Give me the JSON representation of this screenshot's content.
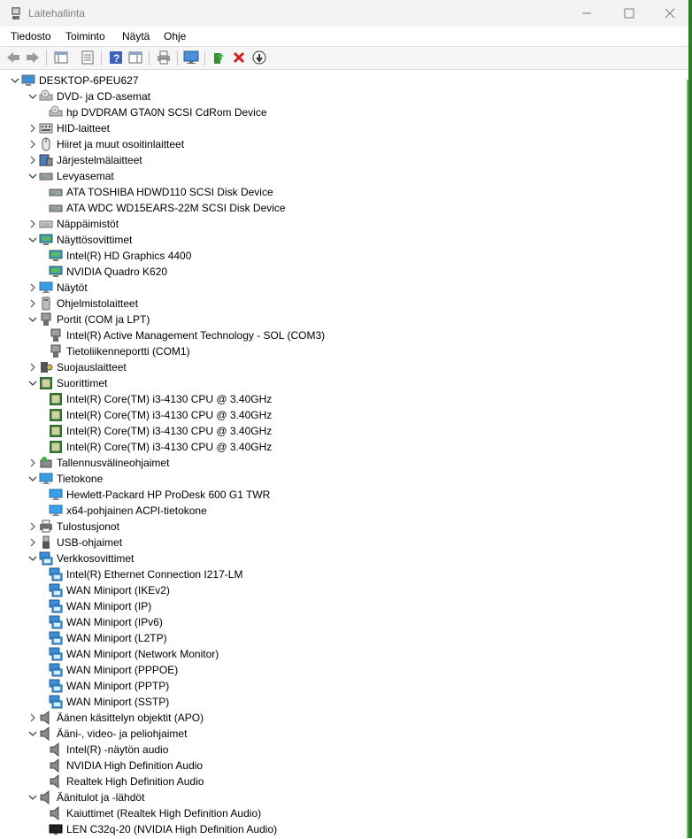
{
  "window": {
    "title": "Laitehallinta"
  },
  "menu": [
    "Tiedosto",
    "Toiminto",
    "Näytä",
    "Ohje"
  ],
  "tree": [
    {
      "level": 0,
      "expanded": true,
      "label": "DESKTOP-6PEU627",
      "icon": "computer-icon"
    },
    {
      "level": 1,
      "expanded": true,
      "label": "DVD- ja CD-asemat",
      "icon": "dvd-drive-icon"
    },
    {
      "level": 2,
      "label": "hp DVDRAM GTA0N SCSI CdRom Device",
      "icon": "dvd-drive-icon"
    },
    {
      "level": 1,
      "expanded": false,
      "label": "HID-laitteet",
      "icon": "hid-icon"
    },
    {
      "level": 1,
      "expanded": false,
      "label": "Hiiret ja muut osoitinlaitteet",
      "icon": "mouse-icon"
    },
    {
      "level": 1,
      "expanded": false,
      "label": "Järjestelmälaitteet",
      "icon": "system-devices-icon"
    },
    {
      "level": 1,
      "expanded": true,
      "label": "Levyasemat",
      "icon": "disk-drive-icon"
    },
    {
      "level": 2,
      "label": "ATA TOSHIBA HDWD110 SCSI Disk Device",
      "icon": "disk-drive-icon"
    },
    {
      "level": 2,
      "label": "ATA WDC WD15EARS-22M SCSI Disk Device",
      "icon": "disk-drive-icon"
    },
    {
      "level": 1,
      "expanded": false,
      "label": "Näppäimistöt",
      "icon": "keyboard-icon"
    },
    {
      "level": 1,
      "expanded": true,
      "label": "Näyttösovittimet",
      "icon": "display-adapter-icon"
    },
    {
      "level": 2,
      "label": "Intel(R) HD Graphics 4400",
      "icon": "display-adapter-icon"
    },
    {
      "level": 2,
      "label": "NVIDIA Quadro K620",
      "icon": "display-adapter-icon"
    },
    {
      "level": 1,
      "expanded": false,
      "label": "Näytöt",
      "icon": "monitor-icon"
    },
    {
      "level": 1,
      "expanded": false,
      "label": "Ohjelmistolaitteet",
      "icon": "software-device-icon"
    },
    {
      "level": 1,
      "expanded": true,
      "label": "Portit (COM ja LPT)",
      "icon": "port-icon"
    },
    {
      "level": 2,
      "label": "Intel(R) Active Management Technology - SOL (COM3)",
      "icon": "port-icon"
    },
    {
      "level": 2,
      "label": "Tietoliikenneportti (COM1)",
      "icon": "port-icon"
    },
    {
      "level": 1,
      "expanded": false,
      "label": "Suojauslaitteet",
      "icon": "security-device-icon"
    },
    {
      "level": 1,
      "expanded": true,
      "label": "Suorittimet",
      "icon": "processor-icon"
    },
    {
      "level": 2,
      "label": "Intel(R) Core(TM) i3-4130 CPU @ 3.40GHz",
      "icon": "processor-icon"
    },
    {
      "level": 2,
      "label": "Intel(R) Core(TM) i3-4130 CPU @ 3.40GHz",
      "icon": "processor-icon"
    },
    {
      "level": 2,
      "label": "Intel(R) Core(TM) i3-4130 CPU @ 3.40GHz",
      "icon": "processor-icon"
    },
    {
      "level": 2,
      "label": "Intel(R) Core(TM) i3-4130 CPU @ 3.40GHz",
      "icon": "processor-icon"
    },
    {
      "level": 1,
      "expanded": false,
      "label": "Tallennusvälineohjaimet",
      "icon": "storage-controller-icon"
    },
    {
      "level": 1,
      "expanded": true,
      "label": "Tietokone",
      "icon": "monitor-icon"
    },
    {
      "level": 2,
      "label": "Hewlett-Packard HP ProDesk 600 G1 TWR",
      "icon": "monitor-icon"
    },
    {
      "level": 2,
      "label": "x64-pohjainen ACPI-tietokone",
      "icon": "monitor-icon"
    },
    {
      "level": 1,
      "expanded": false,
      "label": "Tulostusjonot",
      "icon": "printer-icon"
    },
    {
      "level": 1,
      "expanded": false,
      "label": "USB-ohjaimet",
      "icon": "usb-icon"
    },
    {
      "level": 1,
      "expanded": true,
      "label": "Verkkosovittimet",
      "icon": "network-adapter-icon"
    },
    {
      "level": 2,
      "label": "Intel(R) Ethernet Connection I217-LM",
      "icon": "network-adapter-icon"
    },
    {
      "level": 2,
      "label": "WAN Miniport (IKEv2)",
      "icon": "network-adapter-icon"
    },
    {
      "level": 2,
      "label": "WAN Miniport (IP)",
      "icon": "network-adapter-icon"
    },
    {
      "level": 2,
      "label": "WAN Miniport (IPv6)",
      "icon": "network-adapter-icon"
    },
    {
      "level": 2,
      "label": "WAN Miniport (L2TP)",
      "icon": "network-adapter-icon"
    },
    {
      "level": 2,
      "label": "WAN Miniport (Network Monitor)",
      "icon": "network-adapter-icon"
    },
    {
      "level": 2,
      "label": "WAN Miniport (PPPOE)",
      "icon": "network-adapter-icon"
    },
    {
      "level": 2,
      "label": "WAN Miniport (PPTP)",
      "icon": "network-adapter-icon"
    },
    {
      "level": 2,
      "label": "WAN Miniport (SSTP)",
      "icon": "network-adapter-icon"
    },
    {
      "level": 1,
      "expanded": false,
      "label": "Äänen käsittelyn objektit (APO)",
      "icon": "speaker-icon"
    },
    {
      "level": 1,
      "expanded": true,
      "label": "Ääni-, video- ja peliohjaimet",
      "icon": "speaker-icon"
    },
    {
      "level": 2,
      "label": "Intel(R) -näytön audio",
      "icon": "speaker-icon"
    },
    {
      "level": 2,
      "label": "NVIDIA High Definition Audio",
      "icon": "speaker-icon"
    },
    {
      "level": 2,
      "label": "Realtek High Definition Audio",
      "icon": "speaker-icon"
    },
    {
      "level": 1,
      "expanded": true,
      "label": "Äänitulot ja -lähdöt",
      "icon": "speaker-icon"
    },
    {
      "level": 2,
      "label": "Kaiuttimet (Realtek High Definition Audio)",
      "icon": "speaker-icon"
    },
    {
      "level": 2,
      "label": "LEN C32q-20 (NVIDIA High Definition Audio)",
      "icon": "display-monitor-black-icon"
    }
  ]
}
